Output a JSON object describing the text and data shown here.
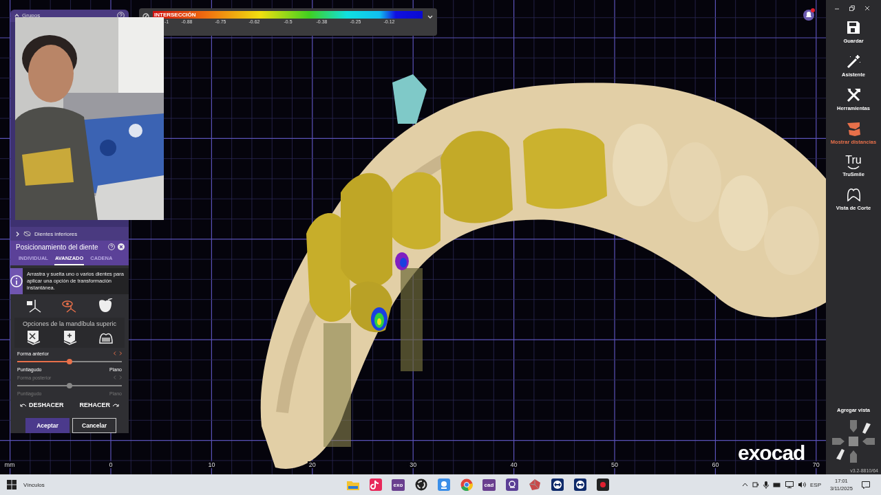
{
  "color_scale": {
    "title": "INTERSECCIÓN",
    "ticks": [
      "-1",
      "-0.88",
      "-0.75",
      "-0.62",
      "-0.5",
      "-0.38",
      "-0.25",
      "-0.12"
    ]
  },
  "viewport": {
    "axis_labels": [
      "mm",
      "0",
      "10",
      "20",
      "30",
      "40",
      "50",
      "60",
      "70"
    ],
    "logo": "exocad"
  },
  "groups_panel": {
    "title": "Grupos",
    "rows": [
      {
        "label": "Dientes inferiores",
        "expanded": false
      }
    ]
  },
  "tool_panel": {
    "title": "Posicionamiento del diente",
    "tabs": [
      {
        "label": "INDIVIDUAL",
        "selected": false
      },
      {
        "label": "AVANZADO",
        "selected": true
      },
      {
        "label": "CADENA",
        "selected": false
      }
    ],
    "info": "Arrastra y suelta uno o varios dientes para aplicar una opción de transformación instantánea.",
    "modes": [
      {
        "kind": "move",
        "selected": false
      },
      {
        "kind": "view",
        "selected": true
      },
      {
        "kind": "tooth",
        "selected": false
      }
    ],
    "section_title": "Opciones de la mandíbula superic",
    "jaw_tools": [
      {
        "kind": "cut"
      },
      {
        "kind": "add"
      },
      {
        "kind": "crown"
      }
    ],
    "sliders": [
      {
        "label": "Forma anterior",
        "disabled": false,
        "level": 0.5,
        "min_label": "Puntiagudo",
        "max_label": "Plano"
      },
      {
        "label": "Forma posterior",
        "disabled": true,
        "level": 0.5,
        "min_label": "Puntiagudo",
        "max_label": "Plano"
      }
    ],
    "undo": "DESHACER",
    "redo": "REHACER",
    "buttons": [
      {
        "label": "Aceptar",
        "kind": "primary"
      },
      {
        "label": "Cancelar",
        "kind": "secondary"
      }
    ]
  },
  "sidebar": {
    "items": [
      {
        "kind": "save",
        "label": "Guardar",
        "selected": false
      },
      {
        "kind": "wand",
        "label": "Asistente",
        "selected": false
      },
      {
        "kind": "tools",
        "label": "Herramientas",
        "selected": false
      },
      {
        "kind": "distances",
        "label": "Mostrar distancias",
        "selected": true
      },
      {
        "kind": "logo",
        "label": "TruSmile",
        "icon_text": "Tru",
        "selected": false
      },
      {
        "kind": "section",
        "label": "Vista de Corte",
        "selected": false
      }
    ],
    "add_view": "Agregar vista",
    "version": "v3.2-8810/64"
  },
  "taskbar": {
    "links": "Vínculos",
    "apps": [
      {
        "kind": "folder"
      },
      {
        "kind": "music"
      },
      {
        "kind": "tile",
        "label": "exo"
      },
      {
        "kind": "obs"
      },
      {
        "kind": "camera"
      },
      {
        "kind": "chrome"
      },
      {
        "kind": "tile",
        "label": "cad"
      },
      {
        "kind": "search"
      },
      {
        "kind": "gem"
      },
      {
        "kind": "remote"
      },
      {
        "kind": "remote"
      },
      {
        "kind": "record"
      }
    ],
    "language": "ESP",
    "time": "17:01",
    "date": "3/11/2025"
  }
}
